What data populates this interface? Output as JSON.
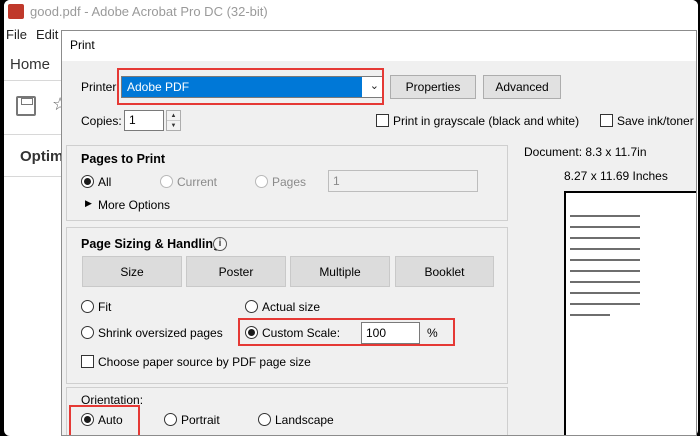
{
  "background_window": {
    "title": "good.pdf - Adobe Acrobat Pro DC (32-bit)",
    "menu": [
      "File",
      "Edit"
    ],
    "home_tab": "Home",
    "sidebar_heading": "Optim"
  },
  "dialog": {
    "title": "Print",
    "printer": {
      "label": "Printer:",
      "value": "Adobe PDF",
      "properties_button": "Properties",
      "advanced_button": "Advanced"
    },
    "copies": {
      "label": "Copies:",
      "value": "1"
    },
    "grayscale": {
      "label": "Print in grayscale (black and white)",
      "checked": false
    },
    "save_ink": {
      "label": "Save ink/toner",
      "checked": false
    },
    "pages_to_print": {
      "heading": "Pages to Print",
      "options": {
        "all": "All",
        "current": "Current",
        "pages": "Pages"
      },
      "selected": "all",
      "pages_range": "1",
      "more_options": "More Options"
    },
    "page_sizing": {
      "heading": "Page Sizing & Handling",
      "buttons": {
        "size": "Size",
        "poster": "Poster",
        "multiple": "Multiple",
        "booklet": "Booklet"
      },
      "options": {
        "fit": "Fit",
        "actual_size": "Actual size",
        "shrink": "Shrink oversized pages",
        "custom_scale": "Custom Scale:"
      },
      "selected": "custom_scale",
      "custom_scale_value": "100",
      "percent_sign": "%",
      "choose_source": {
        "label": "Choose paper source by PDF page size",
        "checked": false
      }
    },
    "orientation": {
      "heading": "Orientation:",
      "options": {
        "auto": "Auto",
        "portrait": "Portrait",
        "landscape": "Landscape"
      },
      "selected": "auto"
    },
    "preview": {
      "document_size": "Document: 8.3 x 11.7in",
      "paper_size": "8.27 x 11.69 Inches"
    }
  },
  "colors": {
    "highlight": "#e53935",
    "selection": "#0078d7"
  }
}
